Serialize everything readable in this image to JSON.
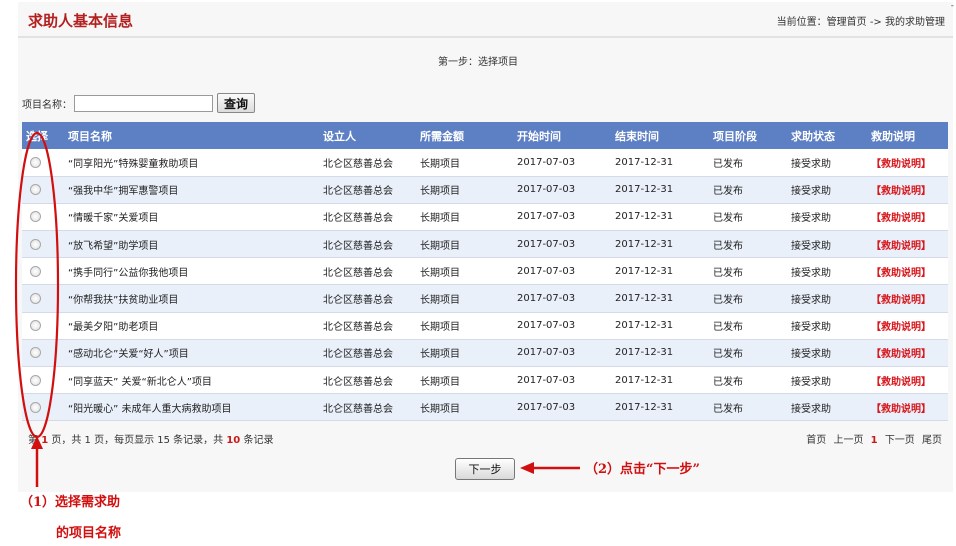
{
  "header": {
    "title": "求助人基本信息",
    "breadcrumb": "当前位置：管理首页 -> 我的求助管理"
  },
  "step_text": "第一步：选择项目",
  "search": {
    "label": "项目名称：",
    "value": "",
    "placeholder": "",
    "button": "查询"
  },
  "table": {
    "columns": [
      "选择",
      "项目名称",
      "设立人",
      "所需金额",
      "开始时间",
      "结束时间",
      "项目阶段",
      "求助状态",
      "救助说明"
    ],
    "rows": [
      {
        "name": "“同享阳光”特殊婴童救助项目",
        "founder": "北仑区慈善总会",
        "amount": "长期项目",
        "start": "2017-07-03",
        "end": "2017-12-31",
        "stage": "已发布",
        "status": "接受求助",
        "help": "【救助说明】"
      },
      {
        "name": "“强我中华”拥军惠警项目",
        "founder": "北仑区慈善总会",
        "amount": "长期项目",
        "start": "2017-07-03",
        "end": "2017-12-31",
        "stage": "已发布",
        "status": "接受求助",
        "help": "【救助说明】"
      },
      {
        "name": "“情暖千家”关爱项目",
        "founder": "北仑区慈善总会",
        "amount": "长期项目",
        "start": "2017-07-03",
        "end": "2017-12-31",
        "stage": "已发布",
        "status": "接受求助",
        "help": "【救助说明】"
      },
      {
        "name": "“放飞希望”助学项目",
        "founder": "北仑区慈善总会",
        "amount": "长期项目",
        "start": "2017-07-03",
        "end": "2017-12-31",
        "stage": "已发布",
        "status": "接受求助",
        "help": "【救助说明】"
      },
      {
        "name": "“携手同行”公益你我他项目",
        "founder": "北仑区慈善总会",
        "amount": "长期项目",
        "start": "2017-07-03",
        "end": "2017-12-31",
        "stage": "已发布",
        "status": "接受求助",
        "help": "【救助说明】"
      },
      {
        "name": "“你帮我扶”扶贫助业项目",
        "founder": "北仑区慈善总会",
        "amount": "长期项目",
        "start": "2017-07-03",
        "end": "2017-12-31",
        "stage": "已发布",
        "status": "接受求助",
        "help": "【救助说明】"
      },
      {
        "name": "“最美夕阳”助老项目",
        "founder": "北仑区慈善总会",
        "amount": "长期项目",
        "start": "2017-07-03",
        "end": "2017-12-31",
        "stage": "已发布",
        "status": "接受求助",
        "help": "【救助说明】"
      },
      {
        "name": "“感动北仑”关爱“好人”项目",
        "founder": "北仑区慈善总会",
        "amount": "长期项目",
        "start": "2017-07-03",
        "end": "2017-12-31",
        "stage": "已发布",
        "status": "接受求助",
        "help": "【救助说明】"
      },
      {
        "name": "“同享蓝天” 关爱“新北仑人”项目",
        "founder": "北仑区慈善总会",
        "amount": "长期项目",
        "start": "2017-07-03",
        "end": "2017-12-31",
        "stage": "已发布",
        "status": "接受求助",
        "help": "【救助说明】"
      },
      {
        "name": "“阳光暖心” 未成年人重大病救助项目",
        "founder": "北仑区慈善总会",
        "amount": "长期项目",
        "start": "2017-07-03",
        "end": "2017-12-31",
        "stage": "已发布",
        "status": "接受求助",
        "help": "【救助说明】"
      }
    ]
  },
  "pager": {
    "prefix": "第",
    "current": "1",
    "mid": "页，共 1 页，每页显示 15 条记录，共",
    "total": "10",
    "suffix": "条记录",
    "first": "首页",
    "prev": "上一页",
    "page": "1",
    "next": "下一页",
    "last": "尾页"
  },
  "next_button": "下一步",
  "annotations": {
    "step2": "（2）点击“下一步”",
    "step1_line1": "（1）选择需求助",
    "step1_line2": "的项目名称",
    "color": "#d10f0f"
  },
  "colors": {
    "header_bg": "#5d7fc3",
    "title": "#b32020",
    "help_link": "#d8161b"
  }
}
